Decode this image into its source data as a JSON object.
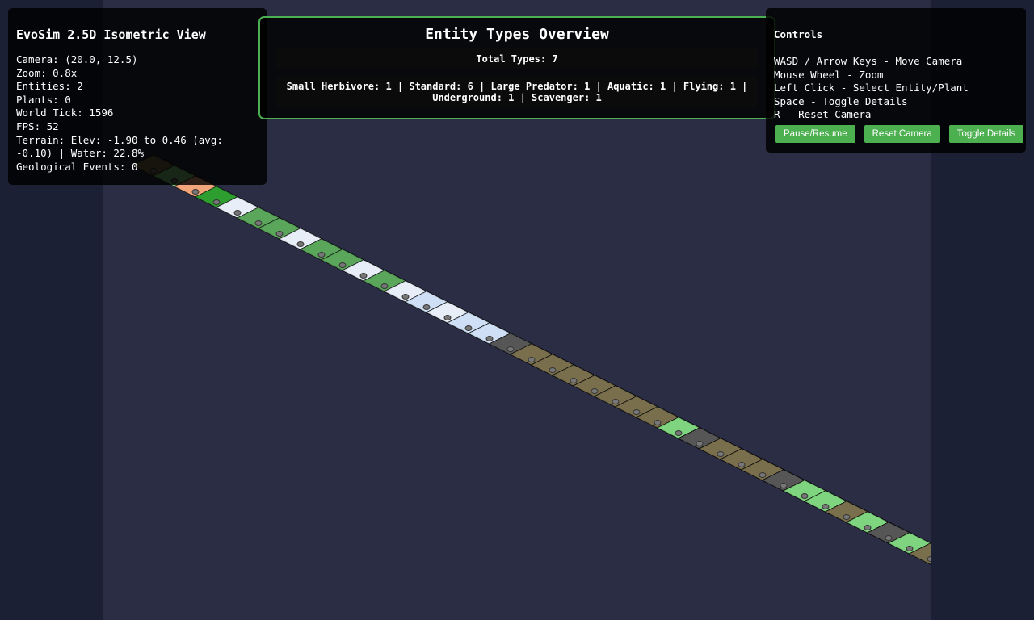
{
  "info": {
    "title": "EvoSim 2.5D Isometric View",
    "camera": "Camera: (20.0, 12.5)",
    "zoom": "Zoom: 0.8x",
    "entities": "Entities: 2",
    "plants": "Plants: 0",
    "tick": "World Tick: 1596",
    "fps": "FPS: 52",
    "terrain": "Terrain: Elev: -1.90 to 0.46 (avg: -0.10) | Water: 22.8%",
    "geo": "Geological Events: 0"
  },
  "overview": {
    "title": "Entity Types Overview",
    "total": "Total Types: 7",
    "breakdown": "Small Herbivore: 1 | Standard: 6 | Large Predator: 1 | Aquatic: 1 | Flying: 1 | Underground: 1 | Scavenger: 1"
  },
  "controls": {
    "title": "Controls",
    "lines": [
      "WASD / Arrow Keys - Move Camera",
      "Mouse Wheel - Zoom",
      "Left Click - Select Entity/Plant",
      "Space - Toggle Details",
      "R - Reset Camera"
    ],
    "buttons": {
      "pause": "Pause/Resume",
      "reset": "Reset Camera",
      "details": "Toggle Details"
    }
  },
  "colors": {
    "accent": "#4caf50",
    "background": "#1b2034",
    "map_background": "#2a2d44"
  },
  "terrain_palette": {
    "grass_dark": "#2e9e30",
    "grass": "#5aa65a",
    "grass_light": "#7fd47f",
    "forest": "#3c8f3c",
    "water": "#3d6fd0",
    "sand": "#f2a57a",
    "rock": "#8e8e8e",
    "snow": "#e8eef8",
    "ice": "#cfe0f6",
    "dirt": "#7a6f4c",
    "mountain": "#565656",
    "lava": "#b3541e"
  }
}
